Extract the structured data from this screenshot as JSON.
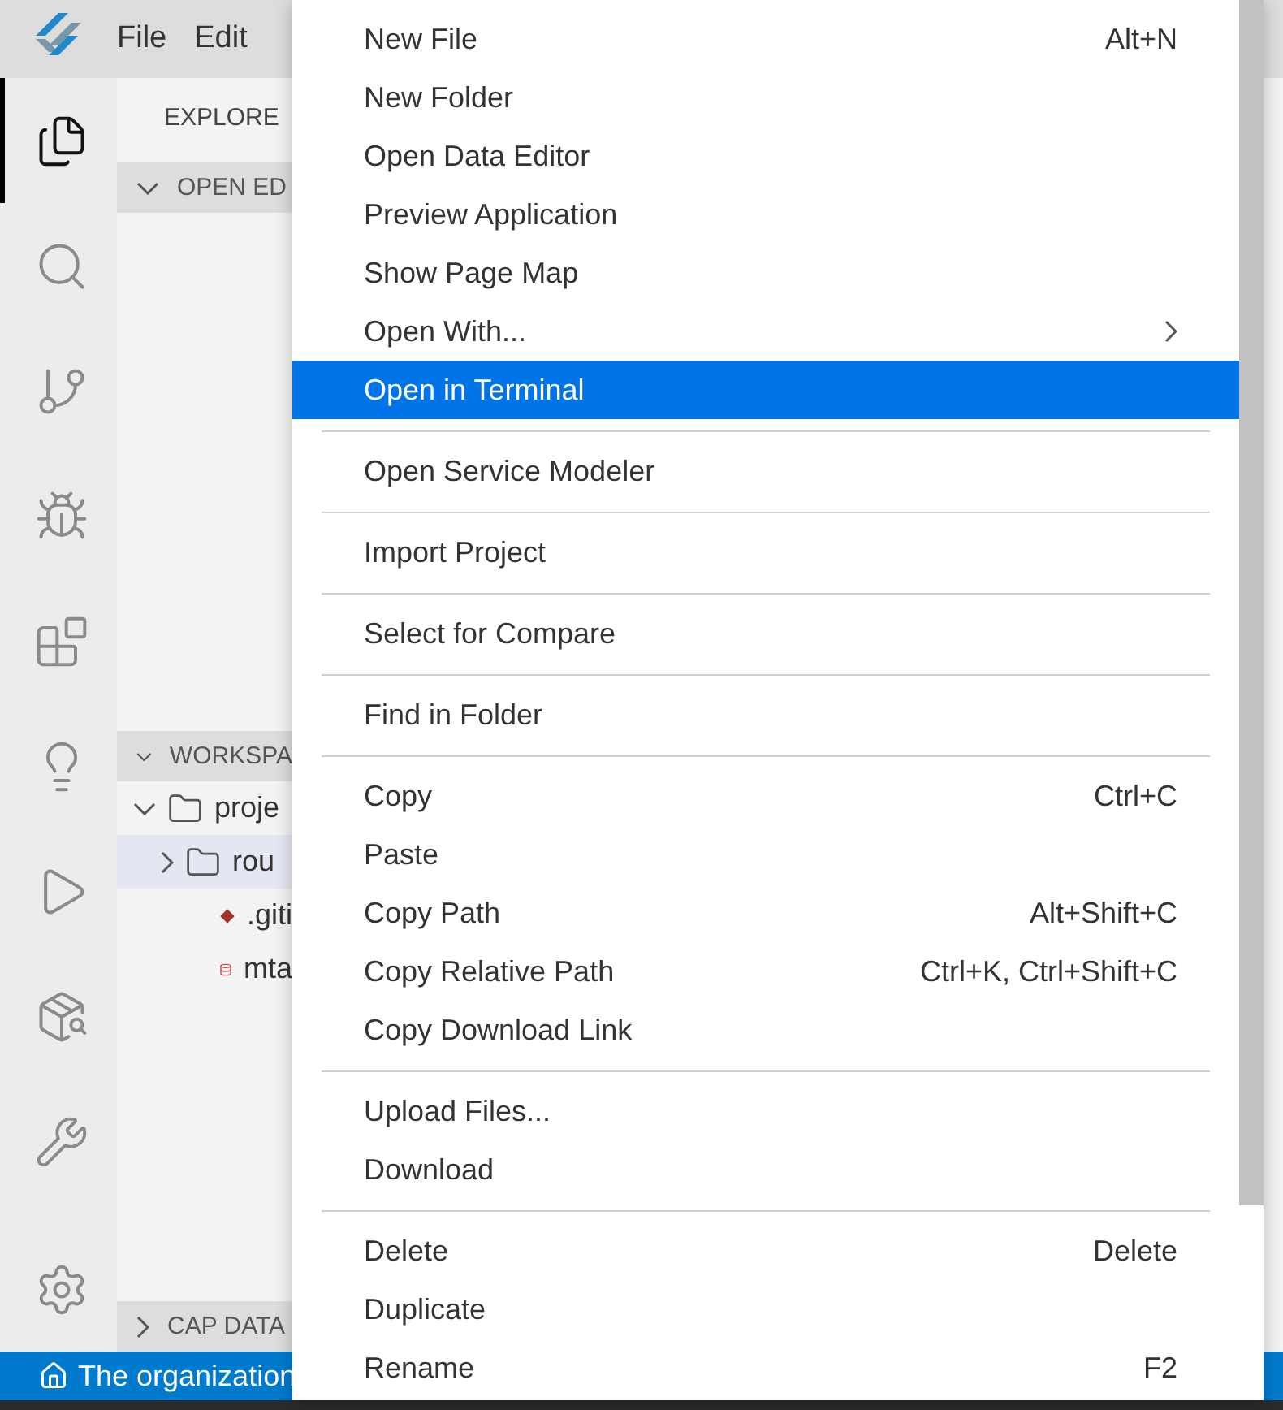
{
  "menu_bar": [
    "File",
    "Edit"
  ],
  "activity_bar": [
    {
      "kind": "files",
      "selected": true
    },
    {
      "kind": "search",
      "selected": false
    },
    {
      "kind": "source-control",
      "selected": false
    },
    {
      "kind": "debug",
      "selected": false
    },
    {
      "kind": "extensions",
      "selected": false
    },
    {
      "kind": "bulb",
      "selected": false
    },
    {
      "kind": "run",
      "selected": false
    },
    {
      "kind": "package-search",
      "selected": false
    },
    {
      "kind": "tools",
      "selected": false
    },
    {
      "kind": "settings",
      "selected": false
    }
  ],
  "sidebar": {
    "title": "EXPLORE",
    "sections": [
      {
        "title": "OPEN ED",
        "expanded": true
      },
      {
        "title": "WORKSPA",
        "expanded": true
      },
      {
        "title": "CAP DATA",
        "expanded": false
      }
    ],
    "tree": [
      {
        "label": "proje",
        "kind": "folder",
        "expanded": true,
        "selected": false,
        "children": [
          {
            "label": "rou",
            "kind": "folder",
            "expanded": false,
            "selected": true
          },
          {
            "label": ".giti",
            "kind": "git",
            "selected": false
          },
          {
            "label": "mta",
            "kind": "database",
            "selected": false
          }
        ]
      }
    ]
  },
  "context_menu": {
    "groups": [
      [
        {
          "label": "New File",
          "shortcut": "Alt+N",
          "selected": false
        },
        {
          "label": "New Folder",
          "selected": false
        },
        {
          "label": "Open Data Editor",
          "selected": false
        },
        {
          "label": "Preview Application",
          "selected": false
        },
        {
          "label": "Show Page Map",
          "selected": false
        },
        {
          "label": "Open With...",
          "submenu": true,
          "selected": false
        },
        {
          "label": "Open in Terminal",
          "selected": true
        }
      ],
      [
        {
          "label": "Open Service Modeler",
          "selected": false
        }
      ],
      [
        {
          "label": "Import Project",
          "selected": false
        }
      ],
      [
        {
          "label": "Select for Compare",
          "selected": false
        }
      ],
      [
        {
          "label": "Find in Folder",
          "selected": false
        }
      ],
      [
        {
          "label": "Copy",
          "shortcut": "Ctrl+C",
          "selected": false
        },
        {
          "label": "Paste",
          "selected": false
        },
        {
          "label": "Copy Path",
          "shortcut": "Alt+Shift+C",
          "selected": false
        },
        {
          "label": "Copy Relative Path",
          "shortcut": "Ctrl+K, Ctrl+Shift+C",
          "selected": false
        },
        {
          "label": "Copy Download Link",
          "selected": false
        }
      ],
      [
        {
          "label": "Upload Files...",
          "selected": false
        },
        {
          "label": "Download",
          "selected": false
        }
      ],
      [
        {
          "label": "Delete",
          "shortcut": "Delete",
          "selected": false
        },
        {
          "label": "Duplicate",
          "selected": false
        },
        {
          "label": "Rename",
          "shortcut": "F2",
          "selected": false
        }
      ]
    ]
  },
  "status_bar": {
    "text": "The organization"
  }
}
